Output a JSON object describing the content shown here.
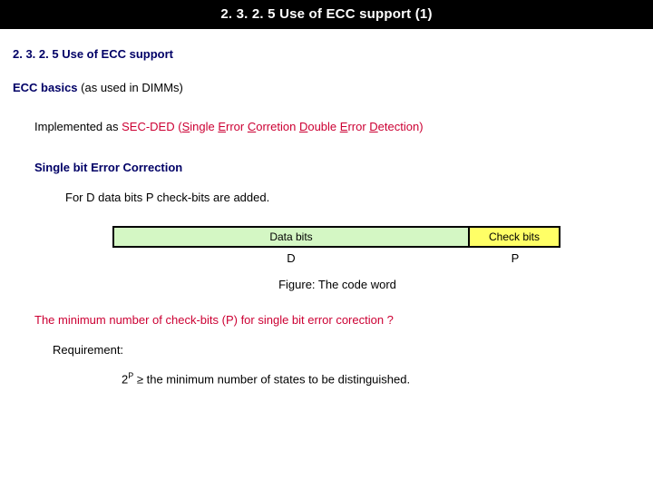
{
  "header": {
    "title": "2. 3. 2. 5 Use of ECC support (1)"
  },
  "section": {
    "title": "2. 3. 2. 5 Use of ECC support"
  },
  "ecc_basics": {
    "label": "ECC basics",
    "note": "  (as used in DIMMs)"
  },
  "impl": {
    "prefix": "Implemented as ",
    "acronym": "SEC-DED",
    "space": " ",
    "exp_open": "(",
    "exp_s": "S",
    "exp_ingle": "ingle ",
    "exp_e1": "E",
    "exp_rror1": "rror ",
    "exp_c": "C",
    "exp_orretion": "orretion ",
    "exp_d": "D",
    "exp_ouble": "ouble ",
    "exp_e2": "E",
    "exp_rror2": "rror ",
    "exp_d2": "D",
    "exp_etection": "etection",
    "exp_close": ")"
  },
  "single_bit_title": "Single bit Error Correction",
  "for_d_line": "For D data bits P check-bits are added.",
  "fig": {
    "data_bits": "Data bits",
    "check_bits": "Check bits",
    "d": "D",
    "p": "P",
    "caption": "Figure: The code word"
  },
  "min_line": "The minimum number of check-bits (P) for single bit  error corection ?",
  "req_label": "Requirement:",
  "req_formula": {
    "base": "2",
    "exp": "P",
    "rest": " ≥ the minimum number of states to be distinguished."
  }
}
